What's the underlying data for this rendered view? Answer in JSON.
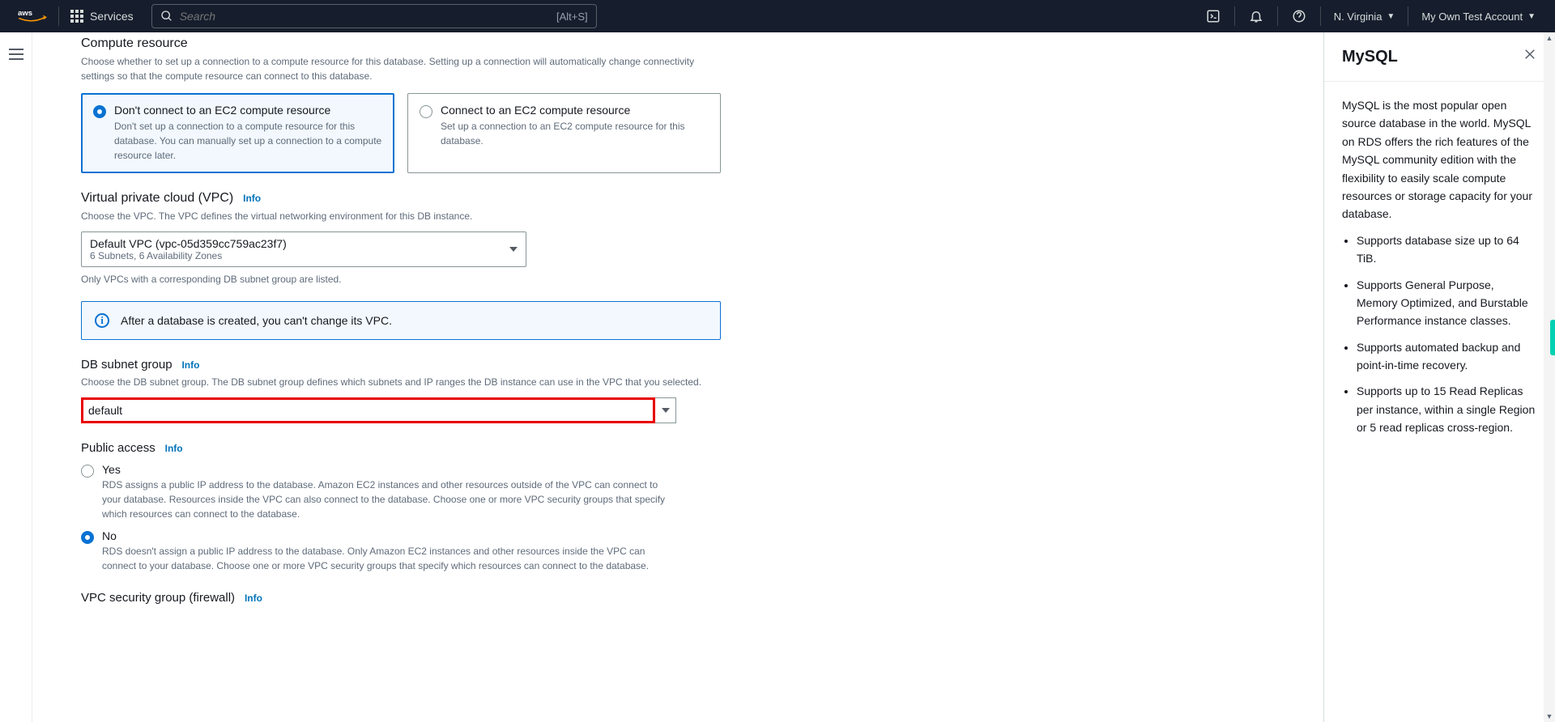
{
  "topnav": {
    "services_label": "Services",
    "search_placeholder": "Search",
    "search_shortcut": "[Alt+S]",
    "region": "N. Virginia",
    "account": "My Own Test Account"
  },
  "compute_resource": {
    "heading": "Compute resource",
    "description": "Choose whether to set up a connection to a compute resource for this database. Setting up a connection will automatically change connectivity settings so that the compute resource can connect to this database.",
    "opt1_title": "Don't connect to an EC2 compute resource",
    "opt1_desc": "Don't set up a connection to a compute resource for this database. You can manually set up a connection to a compute resource later.",
    "opt2_title": "Connect to an EC2 compute resource",
    "opt2_desc": "Set up a connection to an EC2 compute resource for this database."
  },
  "vpc": {
    "heading": "Virtual private cloud (VPC)",
    "info": "Info",
    "description": "Choose the VPC. The VPC defines the virtual networking environment for this DB instance.",
    "selected_main": "Default VPC (vpc-05d359cc759ac23f7)",
    "selected_sub": "6 Subnets, 6 Availability Zones",
    "note": "Only VPCs with a corresponding DB subnet group are listed.",
    "alert": "After a database is created, you can't change its VPC."
  },
  "subnet": {
    "heading": "DB subnet group",
    "info": "Info",
    "description": "Choose the DB subnet group. The DB subnet group defines which subnets and IP ranges the DB instance can use in the VPC that you selected.",
    "value": "default"
  },
  "public_access": {
    "heading": "Public access",
    "info": "Info",
    "yes_label": "Yes",
    "yes_desc": "RDS assigns a public IP address to the database. Amazon EC2 instances and other resources outside of the VPC can connect to your database. Resources inside the VPC can also connect to the database. Choose one or more VPC security groups that specify which resources can connect to the database.",
    "no_label": "No",
    "no_desc": "RDS doesn't assign a public IP address to the database. Only Amazon EC2 instances and other resources inside the VPC can connect to your database. Choose one or more VPC security groups that specify which resources can connect to the database."
  },
  "security_group": {
    "heading": "VPC security group (firewall)",
    "info": "Info"
  },
  "infopanel": {
    "title": "MySQL",
    "intro": "MySQL is the most popular open source database in the world. MySQL on RDS offers the rich features of the MySQL community edition with the flexibility to easily scale compute resources or storage capacity for your database.",
    "bullets": [
      "Supports database size up to 64 TiB.",
      "Supports General Purpose, Memory Optimized, and Burstable Performance instance classes.",
      "Supports automated backup and point-in-time recovery.",
      "Supports up to 15 Read Replicas per instance, within a single Region or 5 read replicas cross-region."
    ]
  }
}
